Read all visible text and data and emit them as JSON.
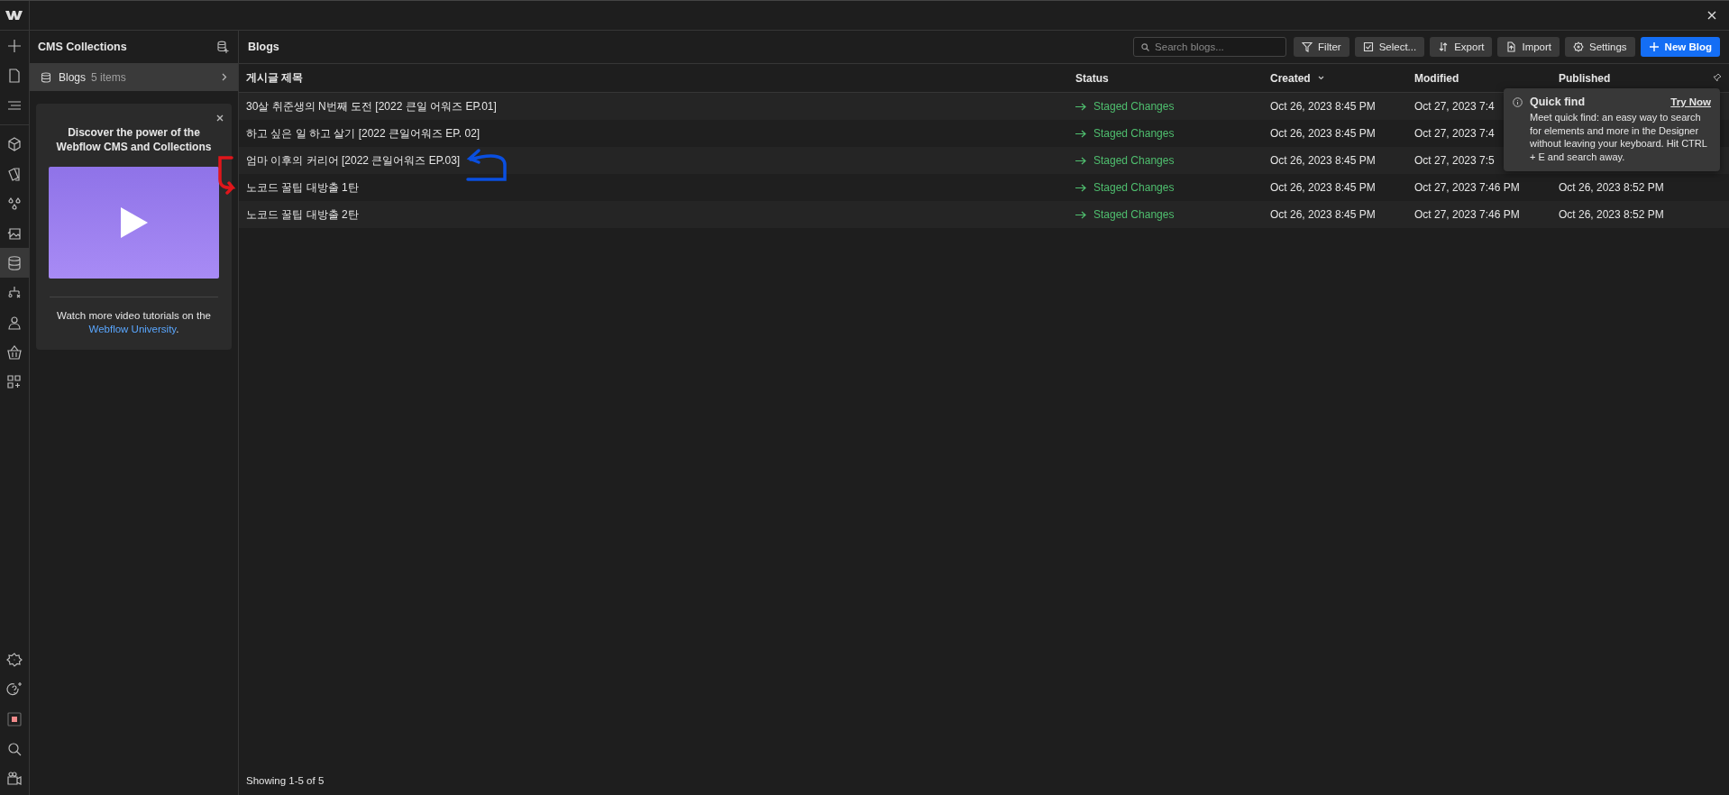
{
  "rail": {
    "top": [
      {
        "selected": false
      },
      {
        "selected": false
      },
      {
        "selected": false
      }
    ],
    "tools": [
      {
        "selected": false
      },
      {
        "selected": false
      },
      {
        "selected": false
      },
      {
        "selected": false
      },
      {
        "selected": true
      },
      {
        "selected": false
      },
      {
        "selected": false
      },
      {
        "selected": false
      },
      {
        "selected": false
      }
    ],
    "bottom": [
      {
        "selected": false
      },
      {
        "selected": false
      },
      {
        "selected": false
      },
      {
        "selected": false
      },
      {
        "selected": false
      }
    ]
  },
  "cms_panel": {
    "title": "CMS Collections",
    "collections": [
      {
        "name": "Blogs",
        "count": "5 items",
        "selected": true
      }
    ],
    "promo": {
      "title": "Discover the power of the Webflow CMS and Collections",
      "text": "Watch more video tutorials on the ",
      "link": "Webflow University",
      "text_end": "."
    }
  },
  "main": {
    "title": "Blogs",
    "search": {
      "placeholder": "Search blogs..."
    },
    "buttons": [
      {
        "label": "Filter",
        "kind": "secondary"
      },
      {
        "label": "Select...",
        "kind": "secondary"
      },
      {
        "label": "Export",
        "kind": "secondary"
      },
      {
        "label": "Import",
        "kind": "secondary"
      },
      {
        "label": "Settings",
        "kind": "secondary"
      },
      {
        "label": "New Blog",
        "kind": "primary"
      }
    ]
  },
  "table": {
    "columns": [
      {
        "label": "게시글 제목",
        "sorted": false
      },
      {
        "label": "Status",
        "sorted": false
      },
      {
        "label": "Created",
        "sorted": true
      },
      {
        "label": "Modified",
        "sorted": false
      },
      {
        "label": "Published",
        "sorted": false
      }
    ],
    "rows": [
      {
        "cells": [
          "30살 취준생의 N번째 도전 [2022 큰일 어워즈 EP.01]",
          "Staged Changes",
          "Oct 26, 2023 8:45 PM",
          "Oct 27, 2023 7:4"
        ]
      },
      {
        "cells": [
          "하고 싶은 일 하고 살기 [2022 큰일어워즈 EP. 02]",
          "Staged Changes",
          "Oct 26, 2023 8:45 PM",
          "Oct 27, 2023 7:4"
        ]
      },
      {
        "cells": [
          "엄마 이후의 커리어 [2022 큰일어워즈 EP.03]",
          "Staged Changes",
          "Oct 26, 2023 8:45 PM",
          "Oct 27, 2023 7:5"
        ]
      },
      {
        "cells": [
          "노코드 꿀팁 대방출 1탄",
          "Staged Changes",
          "Oct 26, 2023 8:45 PM",
          "Oct 27, 2023 7:46 PM",
          "Oct 26, 2023 8:52 PM"
        ]
      },
      {
        "cells": [
          "노코드 꿀팁 대방출 2탄",
          "Staged Changes",
          "Oct 26, 2023 8:45 PM",
          "Oct 27, 2023 7:46 PM",
          "Oct 26, 2023 8:52 PM"
        ]
      }
    ],
    "footer": "Showing 1-5 of 5"
  },
  "tooltip": {
    "title": "Quick find",
    "action": "Try Now",
    "text": "Meet quick find: an easy way to search for elements and more in the Designer without leaving your keyboard. Hit CTRL + E and search away."
  }
}
